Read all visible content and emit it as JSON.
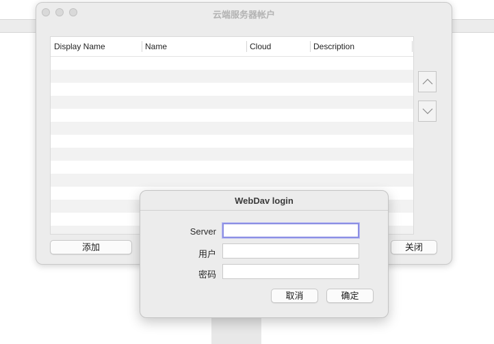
{
  "window": {
    "title": "云端服务器帐户"
  },
  "table": {
    "columns": [
      "Display Name",
      "Name",
      "Cloud",
      "Description"
    ],
    "rows": []
  },
  "buttons": {
    "add": "添加",
    "close": "关闭",
    "move_up_icon": "chevron-up-icon",
    "move_down_icon": "chevron-down-icon"
  },
  "dialog": {
    "title": "WebDav login",
    "fields": [
      {
        "label": "Server",
        "value": "",
        "placeholder": "",
        "focused": true
      },
      {
        "label": "用户",
        "value": "",
        "placeholder": "",
        "focused": false
      },
      {
        "label": "密码",
        "value": "",
        "placeholder": "",
        "focused": false
      }
    ],
    "cancel": "取消",
    "ok": "确定"
  },
  "colors": {
    "focus_ring": "#8c8fe4",
    "window_bg": "#ececec",
    "row_alt": "#f2f2f2"
  }
}
